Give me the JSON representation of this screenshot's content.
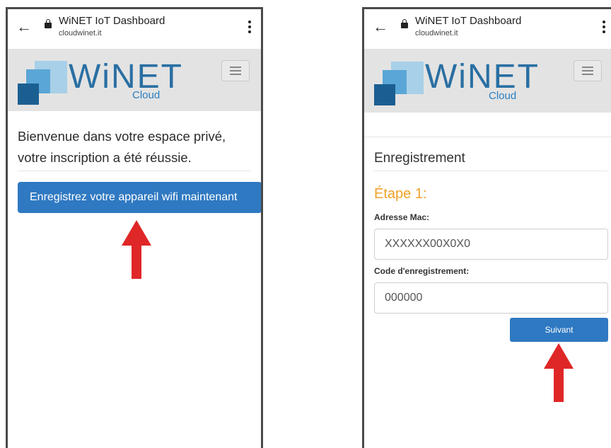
{
  "browser": {
    "title": "WiNET IoT Dashboard",
    "host": "cloudwinet.it"
  },
  "logo": {
    "word": "WiNET",
    "sub": "Cloud"
  },
  "left_screen": {
    "welcome_line1": "Bienvenue dans votre espace privé,",
    "welcome_line2": "votre inscription a été réussie.",
    "register_button": "Enregistrez votre appareil wifi maintenant"
  },
  "right_screen": {
    "section_title": "Enregistrement",
    "step_title": "Étape 1:",
    "mac_label": "Adresse Mac:",
    "mac_value": "XXXXXX00X0X0",
    "code_label": "Code d'enregistrement:",
    "code_value": "000000",
    "next_button": "Suivant"
  },
  "colors": {
    "button_blue": "#2f79c2",
    "step_orange": "#f0a126",
    "arrow_red": "#e02727",
    "header_gray": "#e3e3e3"
  }
}
